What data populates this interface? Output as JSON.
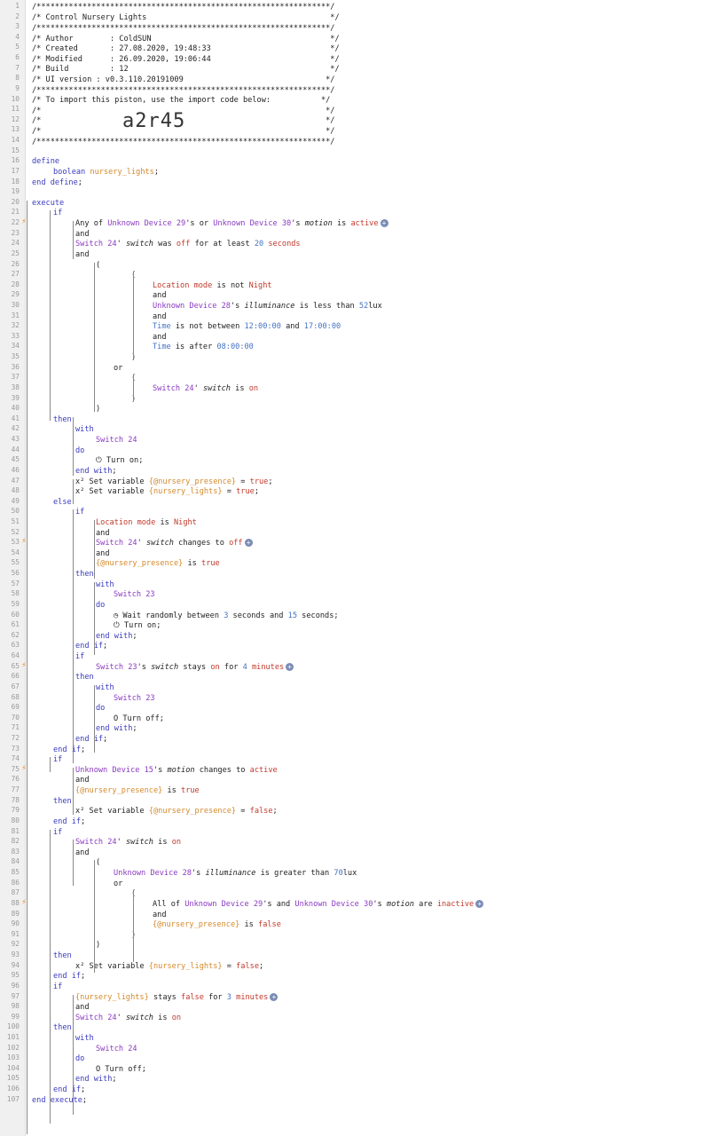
{
  "code_id": "a2r45",
  "header": {
    "border": "/****************************************************************/",
    "title": "/* Control Nursery Lights                                        */",
    "author": "/* Author        : ColdSUN                                       */",
    "created": "/* Created       : 27.08.2020, 19:48:33                          */",
    "modified": "/* Modified      : 26.09.2020, 19:06:44                          */",
    "build": "/* Build         : 12                                            */",
    "ui": "/* UI version : v0.3.110.20191009                               */",
    "import": "/* To import this piston, use the import code below:           */",
    "blank": "/*                                                              */"
  },
  "lines": [
    {
      "n": 16,
      "i": 0,
      "t": [
        [
          "kw",
          "define"
        ]
      ]
    },
    {
      "n": 17,
      "i": 1,
      "t": [
        [
          "kw",
          "boolean "
        ],
        [
          "var",
          "nursery_lights"
        ],
        [
          "",
          "; "
        ]
      ]
    },
    {
      "n": 18,
      "i": 0,
      "t": [
        [
          "kw",
          "end define"
        ],
        [
          "",
          ";"
        ]
      ]
    },
    {
      "n": 20,
      "i": 0,
      "t": [
        [
          "kw",
          "execute"
        ]
      ]
    },
    {
      "n": 21,
      "i": 1,
      "t": [
        [
          "kw",
          "if"
        ]
      ]
    },
    {
      "n": 22,
      "i": 2,
      "tr": true,
      "t": [
        [
          "",
          "Any of "
        ],
        [
          "dev",
          "Unknown Device 29"
        ],
        [
          "",
          "'s or "
        ],
        [
          "dev",
          "Unknown Device 30"
        ],
        [
          "",
          "'s "
        ],
        [
          "attr",
          "motion"
        ],
        [
          "",
          " is "
        ],
        [
          "val",
          "active"
        ]
      ],
      "plus": true
    },
    {
      "n": 23,
      "i": 2,
      "t": [
        [
          "",
          "and"
        ]
      ]
    },
    {
      "n": 24,
      "i": 2,
      "t": [
        [
          "dev",
          "Switch 24"
        ],
        [
          "",
          "' "
        ],
        [
          "attr",
          "switch"
        ],
        [
          "",
          " was "
        ],
        [
          "val",
          "off"
        ],
        [
          "",
          " for at least "
        ],
        [
          "num",
          "20"
        ],
        [
          "",
          " "
        ],
        [
          "val",
          "seconds"
        ]
      ]
    },
    {
      "n": 25,
      "i": 2,
      "t": [
        [
          "",
          "and"
        ]
      ]
    },
    {
      "n": 26,
      "i": 3,
      "t": [
        [
          "",
          "("
        ]
      ]
    },
    {
      "n": 27,
      "i": 5,
      "t": [
        [
          "",
          "("
        ]
      ]
    },
    {
      "n": 28,
      "i": 6,
      "t": [
        [
          "val",
          "Location mode"
        ],
        [
          "",
          " is not "
        ],
        [
          "val",
          "Night"
        ]
      ]
    },
    {
      "n": 29,
      "i": 6,
      "t": [
        [
          "",
          "and"
        ]
      ]
    },
    {
      "n": 30,
      "i": 6,
      "t": [
        [
          "dev",
          "Unknown Device 28"
        ],
        [
          "",
          "'s "
        ],
        [
          "attr",
          "illuminance"
        ],
        [
          "",
          " is less than "
        ],
        [
          "num",
          "52"
        ],
        [
          "",
          "lux"
        ]
      ]
    },
    {
      "n": 31,
      "i": 6,
      "t": [
        [
          "",
          "and"
        ]
      ]
    },
    {
      "n": 32,
      "i": 6,
      "t": [
        [
          "num",
          "Time"
        ],
        [
          "",
          " is not between "
        ],
        [
          "num",
          "12:00:00"
        ],
        [
          "",
          " and "
        ],
        [
          "num",
          "17:00:00"
        ]
      ]
    },
    {
      "n": 33,
      "i": 6,
      "t": [
        [
          "",
          "and"
        ]
      ]
    },
    {
      "n": 34,
      "i": 6,
      "t": [
        [
          "num",
          "Time"
        ],
        [
          "",
          " is after "
        ],
        [
          "num",
          "08:00:00"
        ]
      ]
    },
    {
      "n": 35,
      "i": 5,
      "t": [
        [
          "",
          ")"
        ]
      ]
    },
    {
      "n": 36,
      "i": 4,
      "t": [
        [
          "",
          "or"
        ]
      ]
    },
    {
      "n": 37,
      "i": 5,
      "t": [
        [
          "",
          "("
        ]
      ]
    },
    {
      "n": 38,
      "i": 6,
      "t": [
        [
          "dev",
          "Switch 24"
        ],
        [
          "",
          "' "
        ],
        [
          "attr",
          "switch"
        ],
        [
          "",
          " is "
        ],
        [
          "val",
          "on"
        ]
      ]
    },
    {
      "n": 39,
      "i": 5,
      "t": [
        [
          "",
          ")"
        ]
      ]
    },
    {
      "n": 40,
      "i": 3,
      "t": [
        [
          "",
          ")"
        ]
      ]
    },
    {
      "n": 41,
      "i": 1,
      "t": [
        [
          "kw",
          "then"
        ]
      ]
    },
    {
      "n": 42,
      "i": 2,
      "t": [
        [
          "kw",
          "with"
        ]
      ]
    },
    {
      "n": 43,
      "i": 3,
      "t": [
        [
          "dev",
          "Switch 24"
        ]
      ]
    },
    {
      "n": 44,
      "i": 2,
      "t": [
        [
          "kw",
          "do"
        ]
      ]
    },
    {
      "n": 45,
      "i": 3,
      "t": [
        [
          "",
          "⏻ Turn on;"
        ]
      ]
    },
    {
      "n": 46,
      "i": 2,
      "t": [
        [
          "kw",
          "end with"
        ],
        [
          "",
          ";"
        ]
      ]
    },
    {
      "n": 47,
      "i": 2,
      "t": [
        [
          "",
          "x² Set variable "
        ],
        [
          "var",
          "{@nursery_presence}"
        ],
        [
          "",
          " = "
        ],
        [
          "val",
          "true"
        ],
        [
          "",
          ";"
        ]
      ]
    },
    {
      "n": 48,
      "i": 2,
      "t": [
        [
          "",
          "x² Set variable "
        ],
        [
          "var",
          "{nursery_lights}"
        ],
        [
          "",
          " = "
        ],
        [
          "val",
          "true"
        ],
        [
          "",
          ";"
        ]
      ]
    },
    {
      "n": 49,
      "i": 1,
      "t": [
        [
          "kw",
          "else"
        ]
      ]
    },
    {
      "n": 50,
      "i": 2,
      "t": [
        [
          "kw",
          "if"
        ]
      ]
    },
    {
      "n": 51,
      "i": 3,
      "t": [
        [
          "val",
          "Location mode"
        ],
        [
          "",
          " is "
        ],
        [
          "val",
          "Night"
        ]
      ]
    },
    {
      "n": 52,
      "i": 3,
      "t": [
        [
          "",
          "and"
        ]
      ]
    },
    {
      "n": 53,
      "i": 3,
      "tr": true,
      "t": [
        [
          "dev",
          "Switch 24"
        ],
        [
          "",
          "' "
        ],
        [
          "attr",
          "switch"
        ],
        [
          "",
          " changes to "
        ],
        [
          "val",
          "off"
        ]
      ],
      "plus": true
    },
    {
      "n": 54,
      "i": 3,
      "t": [
        [
          "",
          "and"
        ]
      ]
    },
    {
      "n": 55,
      "i": 3,
      "t": [
        [
          "var",
          "{@nursery_presence}"
        ],
        [
          "",
          " is "
        ],
        [
          "val",
          "true"
        ]
      ]
    },
    {
      "n": 56,
      "i": 2,
      "t": [
        [
          "kw",
          "then"
        ]
      ]
    },
    {
      "n": 57,
      "i": 3,
      "t": [
        [
          "kw",
          "with"
        ]
      ]
    },
    {
      "n": 58,
      "i": 4,
      "t": [
        [
          "dev",
          "Switch 23"
        ]
      ]
    },
    {
      "n": 59,
      "i": 3,
      "t": [
        [
          "kw",
          "do"
        ]
      ]
    },
    {
      "n": 60,
      "i": 4,
      "t": [
        [
          "",
          "◷ Wait randomly between "
        ],
        [
          "num",
          "3"
        ],
        [
          "",
          " seconds and "
        ],
        [
          "num",
          "15"
        ],
        [
          "",
          " seconds;"
        ]
      ]
    },
    {
      "n": 61,
      "i": 4,
      "t": [
        [
          "",
          "⏻ Turn on;"
        ]
      ]
    },
    {
      "n": 62,
      "i": 3,
      "t": [
        [
          "kw",
          "end with"
        ],
        [
          "",
          ";"
        ]
      ]
    },
    {
      "n": 63,
      "i": 2,
      "t": [
        [
          "kw",
          "end if"
        ],
        [
          "",
          ";"
        ]
      ]
    },
    {
      "n": 64,
      "i": 2,
      "t": [
        [
          "kw",
          "if"
        ]
      ]
    },
    {
      "n": 65,
      "i": 3,
      "tr": true,
      "t": [
        [
          "dev",
          "Switch 23"
        ],
        [
          "",
          "'s "
        ],
        [
          "attr",
          "switch"
        ],
        [
          "",
          " stays "
        ],
        [
          "val",
          "on"
        ],
        [
          "",
          " for "
        ],
        [
          "num",
          "4"
        ],
        [
          "",
          " "
        ],
        [
          "val",
          "minutes"
        ]
      ],
      "plus": true
    },
    {
      "n": 66,
      "i": 2,
      "t": [
        [
          "kw",
          "then"
        ]
      ]
    },
    {
      "n": 67,
      "i": 3,
      "t": [
        [
          "kw",
          "with"
        ]
      ]
    },
    {
      "n": 68,
      "i": 4,
      "t": [
        [
          "dev",
          "Switch 23"
        ]
      ]
    },
    {
      "n": 69,
      "i": 3,
      "t": [
        [
          "kw",
          "do"
        ]
      ]
    },
    {
      "n": 70,
      "i": 4,
      "t": [
        [
          "",
          "O Turn off;"
        ]
      ]
    },
    {
      "n": 71,
      "i": 3,
      "t": [
        [
          "kw",
          "end with"
        ],
        [
          "",
          ";"
        ]
      ]
    },
    {
      "n": 72,
      "i": 2,
      "t": [
        [
          "kw",
          "end if"
        ],
        [
          "",
          ";"
        ]
      ]
    },
    {
      "n": 73,
      "i": 1,
      "t": [
        [
          "kw",
          "end if"
        ],
        [
          "",
          ";"
        ]
      ]
    },
    {
      "n": 74,
      "i": 1,
      "t": [
        [
          "kw",
          "if"
        ]
      ]
    },
    {
      "n": 75,
      "i": 2,
      "tr": true,
      "t": [
        [
          "dev",
          "Unknown Device 15"
        ],
        [
          "",
          "'s "
        ],
        [
          "attr",
          "motion"
        ],
        [
          "",
          " changes to "
        ],
        [
          "val",
          "active"
        ]
      ]
    },
    {
      "n": 76,
      "i": 2,
      "t": [
        [
          "",
          "and"
        ]
      ]
    },
    {
      "n": 77,
      "i": 2,
      "t": [
        [
          "var",
          "{@nursery_presence}"
        ],
        [
          "",
          " is "
        ],
        [
          "val",
          "true"
        ]
      ]
    },
    {
      "n": 78,
      "i": 1,
      "t": [
        [
          "kw",
          "then"
        ]
      ]
    },
    {
      "n": 79,
      "i": 2,
      "t": [
        [
          "",
          "x² Set variable "
        ],
        [
          "var",
          "{@nursery_presence}"
        ],
        [
          "",
          " = "
        ],
        [
          "val",
          "false"
        ],
        [
          "",
          ";"
        ]
      ]
    },
    {
      "n": 80,
      "i": 1,
      "t": [
        [
          "kw",
          "end if"
        ],
        [
          "",
          ";"
        ]
      ]
    },
    {
      "n": 81,
      "i": 1,
      "t": [
        [
          "kw",
          "if"
        ]
      ]
    },
    {
      "n": 82,
      "i": 2,
      "t": [
        [
          "dev",
          "Switch 24"
        ],
        [
          "",
          "' "
        ],
        [
          "attr",
          "switch"
        ],
        [
          "",
          " is "
        ],
        [
          "val",
          "on"
        ]
      ]
    },
    {
      "n": 83,
      "i": 2,
      "t": [
        [
          "",
          "and"
        ]
      ]
    },
    {
      "n": 84,
      "i": 3,
      "t": [
        [
          "",
          "("
        ]
      ]
    },
    {
      "n": 85,
      "i": 4,
      "t": [
        [
          "dev",
          "Unknown Device 28"
        ],
        [
          "",
          "'s "
        ],
        [
          "attr",
          "illuminance"
        ],
        [
          "",
          " is greater than "
        ],
        [
          "num",
          "70"
        ],
        [
          "",
          "lux"
        ]
      ]
    },
    {
      "n": 86,
      "i": 4,
      "t": [
        [
          "",
          "or"
        ]
      ]
    },
    {
      "n": 87,
      "i": 5,
      "t": [
        [
          "",
          "("
        ]
      ]
    },
    {
      "n": 88,
      "i": 6,
      "tr": true,
      "t": [
        [
          "",
          "All of "
        ],
        [
          "dev",
          "Unknown Device 29"
        ],
        [
          "",
          "'s and "
        ],
        [
          "dev",
          "Unknown Device 30"
        ],
        [
          "",
          "'s "
        ],
        [
          "attr",
          "motion"
        ],
        [
          "",
          " are "
        ],
        [
          "val",
          "inactive"
        ]
      ],
      "plus": true
    },
    {
      "n": 89,
      "i": 6,
      "t": [
        [
          "",
          "and"
        ]
      ]
    },
    {
      "n": 90,
      "i": 6,
      "t": [
        [
          "var",
          "{@nursery_presence}"
        ],
        [
          "",
          " is "
        ],
        [
          "val",
          "false"
        ]
      ]
    },
    {
      "n": 91,
      "i": 5,
      "t": [
        [
          "",
          ")"
        ]
      ]
    },
    {
      "n": 92,
      "i": 3,
      "t": [
        [
          "",
          ")"
        ]
      ]
    },
    {
      "n": 93,
      "i": 1,
      "t": [
        [
          "kw",
          "then"
        ]
      ]
    },
    {
      "n": 94,
      "i": 2,
      "t": [
        [
          "",
          "x² Set variable "
        ],
        [
          "var",
          "{nursery_lights}"
        ],
        [
          "",
          " = "
        ],
        [
          "val",
          "false"
        ],
        [
          "",
          ";"
        ]
      ]
    },
    {
      "n": 95,
      "i": 1,
      "t": [
        [
          "kw",
          "end if"
        ],
        [
          "",
          ";"
        ]
      ]
    },
    {
      "n": 96,
      "i": 1,
      "t": [
        [
          "kw",
          "if"
        ]
      ]
    },
    {
      "n": 97,
      "i": 2,
      "t": [
        [
          "var",
          "{nursery_lights}"
        ],
        [
          "",
          " stays "
        ],
        [
          "val",
          "false"
        ],
        [
          "",
          " for "
        ],
        [
          "num",
          "3"
        ],
        [
          "",
          " "
        ],
        [
          "val",
          "minutes"
        ]
      ],
      "plus": true
    },
    {
      "n": 98,
      "i": 2,
      "t": [
        [
          "",
          "and"
        ]
      ]
    },
    {
      "n": 99,
      "i": 2,
      "t": [
        [
          "dev",
          "Switch 24"
        ],
        [
          "",
          "' "
        ],
        [
          "attr",
          "switch"
        ],
        [
          "",
          " is "
        ],
        [
          "val",
          "on"
        ]
      ]
    },
    {
      "n": 100,
      "i": 1,
      "t": [
        [
          "kw",
          "then"
        ]
      ]
    },
    {
      "n": 101,
      "i": 2,
      "t": [
        [
          "kw",
          "with"
        ]
      ]
    },
    {
      "n": 102,
      "i": 3,
      "t": [
        [
          "dev",
          "Switch 24"
        ]
      ]
    },
    {
      "n": 103,
      "i": 2,
      "t": [
        [
          "kw",
          "do"
        ]
      ]
    },
    {
      "n": 104,
      "i": 3,
      "t": [
        [
          "",
          "O Turn off;"
        ]
      ]
    },
    {
      "n": 105,
      "i": 2,
      "t": [
        [
          "kw",
          "end with"
        ],
        [
          "",
          ";"
        ]
      ]
    },
    {
      "n": 106,
      "i": 1,
      "t": [
        [
          "kw",
          "end if"
        ],
        [
          "",
          ";"
        ]
      ]
    },
    {
      "n": 107,
      "i": 0,
      "t": [
        [
          "kw",
          "end execute"
        ],
        [
          "",
          ";"
        ]
      ]
    }
  ],
  "blank_lines": [
    15,
    19
  ],
  "colors": {
    "keyword": "#3a3abf",
    "device": "#8a39c2",
    "value": "#c0392b",
    "variable": "#d4892a",
    "number": "#4472c4",
    "trigger": "#f08a24"
  }
}
